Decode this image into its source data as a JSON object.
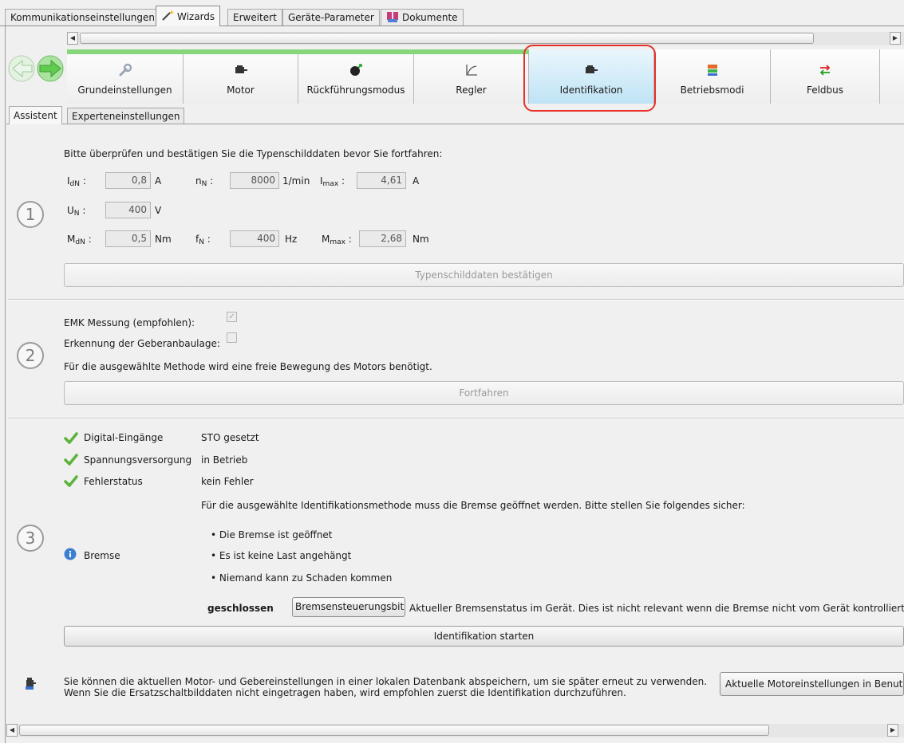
{
  "top_tabs": [
    {
      "label": "Kommunikationseinstellungen"
    },
    {
      "label": "Wizards",
      "icon": "wand-icon"
    },
    {
      "label": "Erweitert"
    },
    {
      "label": "Geräte-Parameter"
    },
    {
      "label": "Dokumente",
      "icon": "documents-icon"
    }
  ],
  "wizard_steps": [
    {
      "label": "Grundeinstellungen",
      "icon": "wrench-icon",
      "done": true
    },
    {
      "label": "Motor",
      "icon": "motor-icon",
      "done": true
    },
    {
      "label": "Rückführungsmodus",
      "icon": "encoder-icon",
      "done": true
    },
    {
      "label": "Regler",
      "icon": "controller-curve-icon",
      "done": true
    },
    {
      "label": "Identifikation",
      "icon": "motor-icon",
      "active": true
    },
    {
      "label": "Betriebsmodi",
      "icon": "modes-icon"
    },
    {
      "label": "Feldbus",
      "icon": "fieldbus-arrows-icon"
    }
  ],
  "sub_tabs": [
    "Assistent",
    "Experteneinstellungen"
  ],
  "section1": {
    "number": "1",
    "intro": "Bitte überprüfen und bestätigen Sie die Typenschilddaten bevor Sie fortfahren:",
    "idn": {
      "sym": "I",
      "sub": "dN",
      "value": "0,8",
      "unit": "A"
    },
    "nn": {
      "sym": "n",
      "sub": "N",
      "value": "8000",
      "unit": "1/min"
    },
    "imax": {
      "sym": "I",
      "sub": "max",
      "value": "4,61",
      "unit": "A"
    },
    "un": {
      "sym": "U",
      "sub": "N",
      "value": "400",
      "unit": "V"
    },
    "mdn": {
      "sym": "M",
      "sub": "dN",
      "value": "0,5",
      "unit": "Nm"
    },
    "fn": {
      "sym": "f",
      "sub": "N",
      "value": "400",
      "unit": "Hz"
    },
    "mmax": {
      "sym": "M",
      "sub": "max",
      "value": "2,68",
      "unit": "Nm"
    },
    "colon": ":",
    "confirm_button": "Typenschilddaten bestätigen"
  },
  "section2": {
    "number": "2",
    "emk_label": "EMK Messung (empfohlen):",
    "emk_checked": true,
    "geber_label": "Erkennung der Geberanbaulage:",
    "geber_checked": false,
    "note": "Für die ausgewählte Methode wird eine freie Bewegung des Motors benötigt.",
    "continue_button": "Fortfahren"
  },
  "section3": {
    "number": "3",
    "status": [
      {
        "label": "Digital-Eingänge",
        "value": "STO gesetzt"
      },
      {
        "label": "Spannungsversorgung",
        "value": "in Betrieb"
      },
      {
        "label": "Fehlerstatus",
        "value": "kein Fehler"
      }
    ],
    "brake_intro": "Für die ausgewählte Identifikationsmethode muss die Bremse geöffnet werden. Bitte stellen Sie folgendes sicher:",
    "brake_label": "Bremse",
    "bullets": [
      "Die Bremse ist geöffnet",
      "Es ist keine Last angehängt",
      "Niemand kann zu Schaden kommen"
    ],
    "brake_state": "geschlossen",
    "brake_button": "Bremsensteuerungsbit",
    "brake_note": "Aktueller Bremsenstatus im Gerät. Dies ist nicht relevant wenn die Bremse nicht vom Gerät kontrolliert",
    "start_button": "Identifikation starten"
  },
  "footer": {
    "line1": "Sie können die aktuellen Motor- und Gebereinstellungen in einer lokalen Datenbank abspeichern, um sie später erneut zu verwenden.",
    "line2": "Wenn Sie die Ersatzschaltbilddaten nicht eingetragen haben, wird empfohlen zuerst die Identifikation durchzuführen.",
    "save_button": "Aktuelle Motoreinstellungen in Benutz"
  },
  "colors": {
    "progress": "#86d77c",
    "highlight": "#e8302a",
    "check": "#5cb33c",
    "info": "#3d7fcf"
  }
}
